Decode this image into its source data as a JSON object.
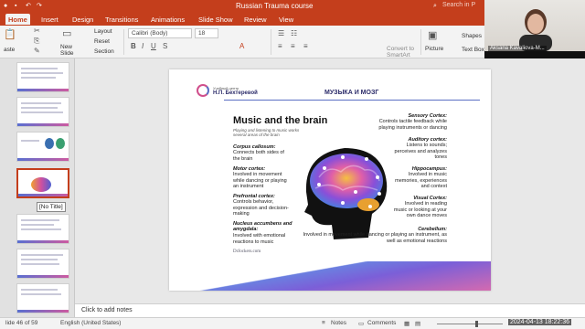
{
  "window": {
    "title": "Russian Trauma course",
    "search_placeholder": "Search in P"
  },
  "tabs": [
    "Home",
    "Insert",
    "Design",
    "Transitions",
    "Animations",
    "Slide Show",
    "Review",
    "View"
  ],
  "ribbon": {
    "paste_label": "aste",
    "new_slide_label": "New\nSlide",
    "layout_label": "Layout",
    "reset_label": "Reset",
    "section_label": "Section",
    "font_name": "Calibri (Body)",
    "font_size": "18",
    "convert_label": "Convert to\nSmartArt",
    "picture_label": "Picture",
    "shapes_label": "Shapes",
    "textbox_label": "Text Box"
  },
  "webcam": {
    "name": "Aksana Kavaliova-M..."
  },
  "thumbnails": {
    "tooltip": "[No Title]",
    "selected_index": 4
  },
  "slide": {
    "logo_small": "Учебный центр",
    "logo_name": "Н.П. Бехтеревой",
    "header": "МУЗЫКА И МОЗГ",
    "infographic": {
      "title": "Music and the brain",
      "subtitle": "Playing and listening to music works several areas of the brain",
      "regions": [
        {
          "name": "Corpus callosum:",
          "desc": "Connects both sides of the brain"
        },
        {
          "name": "Motor cortex:",
          "desc": "Involved in movement while dancing or playing an instrument"
        },
        {
          "name": "Prefrontal cortex:",
          "desc": "Controls behavior, expression and decision-making"
        },
        {
          "name": "Nucleus accumbens and amygdala:",
          "desc": "Involved with emotional reactions to music"
        },
        {
          "name": "Sensory Cortex:",
          "desc": "Controls tactile feedback while playing instruments or dancing"
        },
        {
          "name": "Auditory cortex:",
          "desc": "Listens to sounds; perceives and analyzes tones"
        },
        {
          "name": "Hippocampus:",
          "desc": "Involved in music memories, experiences and context"
        },
        {
          "name": "Visual Cortex:",
          "desc": "Involved in reading music or looking at your own dance moves"
        },
        {
          "name": "Cerebellum:",
          "desc": "Involved in movement while dancing or playing an instrument, as well as emotional reactions"
        }
      ],
      "source_logo": "DrJockers.com"
    }
  },
  "notes": {
    "placeholder": "Click to add notes"
  },
  "status": {
    "slide_info": "lide 46 of 59",
    "language": "English (United States)",
    "notes_btn": "Notes",
    "comments_btn": "Comments",
    "timestamp": "2024-04-13  18:22:36"
  },
  "colors": {
    "accent": "#c43e1c"
  }
}
